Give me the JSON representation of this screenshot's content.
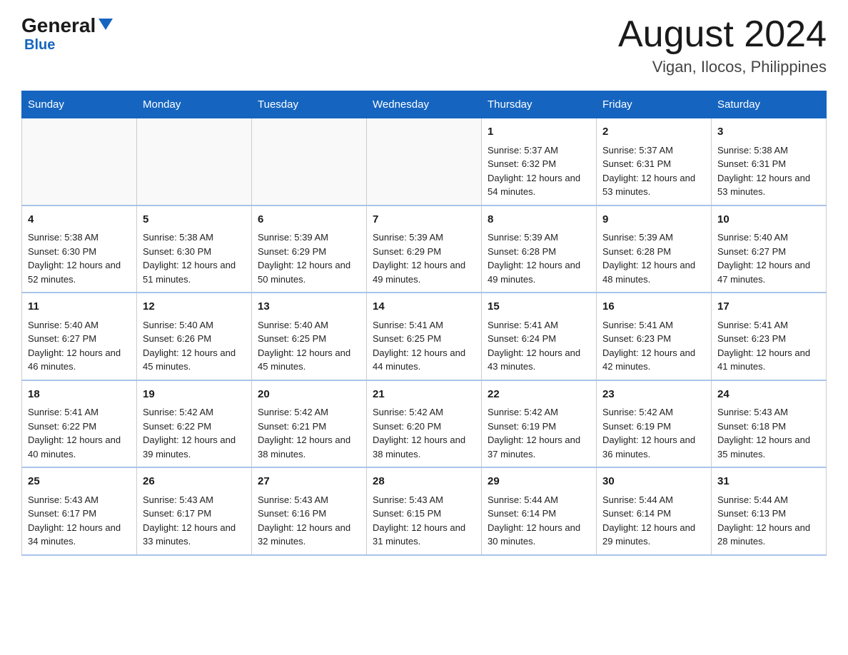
{
  "header": {
    "logo_general": "General",
    "logo_blue": "Blue",
    "main_title": "August 2024",
    "subtitle": "Vigan, Ilocos, Philippines"
  },
  "calendar": {
    "days_of_week": [
      "Sunday",
      "Monday",
      "Tuesday",
      "Wednesday",
      "Thursday",
      "Friday",
      "Saturday"
    ],
    "weeks": [
      [
        {
          "day": "",
          "info": ""
        },
        {
          "day": "",
          "info": ""
        },
        {
          "day": "",
          "info": ""
        },
        {
          "day": "",
          "info": ""
        },
        {
          "day": "1",
          "info": "Sunrise: 5:37 AM\nSunset: 6:32 PM\nDaylight: 12 hours and 54 minutes."
        },
        {
          "day": "2",
          "info": "Sunrise: 5:37 AM\nSunset: 6:31 PM\nDaylight: 12 hours and 53 minutes."
        },
        {
          "day": "3",
          "info": "Sunrise: 5:38 AM\nSunset: 6:31 PM\nDaylight: 12 hours and 53 minutes."
        }
      ],
      [
        {
          "day": "4",
          "info": "Sunrise: 5:38 AM\nSunset: 6:30 PM\nDaylight: 12 hours and 52 minutes."
        },
        {
          "day": "5",
          "info": "Sunrise: 5:38 AM\nSunset: 6:30 PM\nDaylight: 12 hours and 51 minutes."
        },
        {
          "day": "6",
          "info": "Sunrise: 5:39 AM\nSunset: 6:29 PM\nDaylight: 12 hours and 50 minutes."
        },
        {
          "day": "7",
          "info": "Sunrise: 5:39 AM\nSunset: 6:29 PM\nDaylight: 12 hours and 49 minutes."
        },
        {
          "day": "8",
          "info": "Sunrise: 5:39 AM\nSunset: 6:28 PM\nDaylight: 12 hours and 49 minutes."
        },
        {
          "day": "9",
          "info": "Sunrise: 5:39 AM\nSunset: 6:28 PM\nDaylight: 12 hours and 48 minutes."
        },
        {
          "day": "10",
          "info": "Sunrise: 5:40 AM\nSunset: 6:27 PM\nDaylight: 12 hours and 47 minutes."
        }
      ],
      [
        {
          "day": "11",
          "info": "Sunrise: 5:40 AM\nSunset: 6:27 PM\nDaylight: 12 hours and 46 minutes."
        },
        {
          "day": "12",
          "info": "Sunrise: 5:40 AM\nSunset: 6:26 PM\nDaylight: 12 hours and 45 minutes."
        },
        {
          "day": "13",
          "info": "Sunrise: 5:40 AM\nSunset: 6:25 PM\nDaylight: 12 hours and 45 minutes."
        },
        {
          "day": "14",
          "info": "Sunrise: 5:41 AM\nSunset: 6:25 PM\nDaylight: 12 hours and 44 minutes."
        },
        {
          "day": "15",
          "info": "Sunrise: 5:41 AM\nSunset: 6:24 PM\nDaylight: 12 hours and 43 minutes."
        },
        {
          "day": "16",
          "info": "Sunrise: 5:41 AM\nSunset: 6:23 PM\nDaylight: 12 hours and 42 minutes."
        },
        {
          "day": "17",
          "info": "Sunrise: 5:41 AM\nSunset: 6:23 PM\nDaylight: 12 hours and 41 minutes."
        }
      ],
      [
        {
          "day": "18",
          "info": "Sunrise: 5:41 AM\nSunset: 6:22 PM\nDaylight: 12 hours and 40 minutes."
        },
        {
          "day": "19",
          "info": "Sunrise: 5:42 AM\nSunset: 6:22 PM\nDaylight: 12 hours and 39 minutes."
        },
        {
          "day": "20",
          "info": "Sunrise: 5:42 AM\nSunset: 6:21 PM\nDaylight: 12 hours and 38 minutes."
        },
        {
          "day": "21",
          "info": "Sunrise: 5:42 AM\nSunset: 6:20 PM\nDaylight: 12 hours and 38 minutes."
        },
        {
          "day": "22",
          "info": "Sunrise: 5:42 AM\nSunset: 6:19 PM\nDaylight: 12 hours and 37 minutes."
        },
        {
          "day": "23",
          "info": "Sunrise: 5:42 AM\nSunset: 6:19 PM\nDaylight: 12 hours and 36 minutes."
        },
        {
          "day": "24",
          "info": "Sunrise: 5:43 AM\nSunset: 6:18 PM\nDaylight: 12 hours and 35 minutes."
        }
      ],
      [
        {
          "day": "25",
          "info": "Sunrise: 5:43 AM\nSunset: 6:17 PM\nDaylight: 12 hours and 34 minutes."
        },
        {
          "day": "26",
          "info": "Sunrise: 5:43 AM\nSunset: 6:17 PM\nDaylight: 12 hours and 33 minutes."
        },
        {
          "day": "27",
          "info": "Sunrise: 5:43 AM\nSunset: 6:16 PM\nDaylight: 12 hours and 32 minutes."
        },
        {
          "day": "28",
          "info": "Sunrise: 5:43 AM\nSunset: 6:15 PM\nDaylight: 12 hours and 31 minutes."
        },
        {
          "day": "29",
          "info": "Sunrise: 5:44 AM\nSunset: 6:14 PM\nDaylight: 12 hours and 30 minutes."
        },
        {
          "day": "30",
          "info": "Sunrise: 5:44 AM\nSunset: 6:14 PM\nDaylight: 12 hours and 29 minutes."
        },
        {
          "day": "31",
          "info": "Sunrise: 5:44 AM\nSunset: 6:13 PM\nDaylight: 12 hours and 28 minutes."
        }
      ]
    ]
  }
}
